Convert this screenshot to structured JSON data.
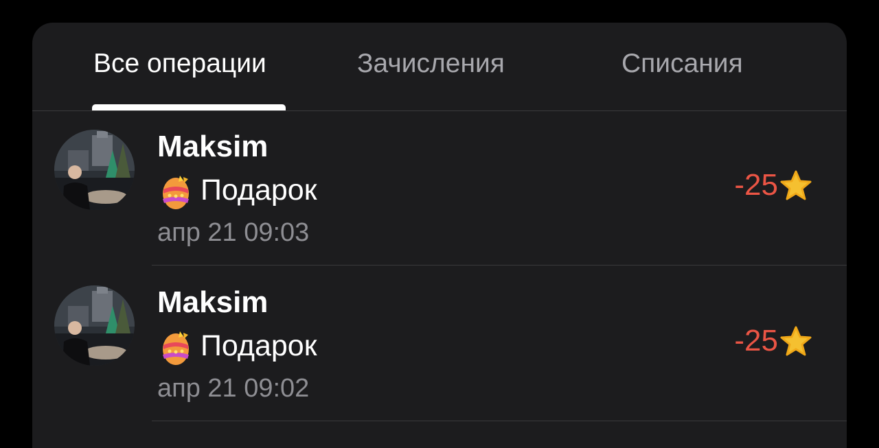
{
  "tabs": [
    {
      "label": "Все операции",
      "active": true
    },
    {
      "label": "Зачисления",
      "active": false
    },
    {
      "label": "Списания",
      "active": false
    }
  ],
  "transactions": [
    {
      "name": "Maksim",
      "icon": "easter-egg-icon",
      "description": "Подарок",
      "date": "апр 21 09:03",
      "amount": "-25",
      "currency_icon": "star-icon"
    },
    {
      "name": "Maksim",
      "icon": "easter-egg-icon",
      "description": "Подарок",
      "date": "апр 21 09:02",
      "amount": "-25",
      "currency_icon": "star-icon"
    }
  ],
  "colors": {
    "background": "#000000",
    "panel": "#1c1c1e",
    "text_primary": "#ffffff",
    "text_secondary": "#8e8e93",
    "tab_inactive": "#a8a8ad",
    "amount_negative": "#eb5545",
    "star": "#f5c030"
  }
}
